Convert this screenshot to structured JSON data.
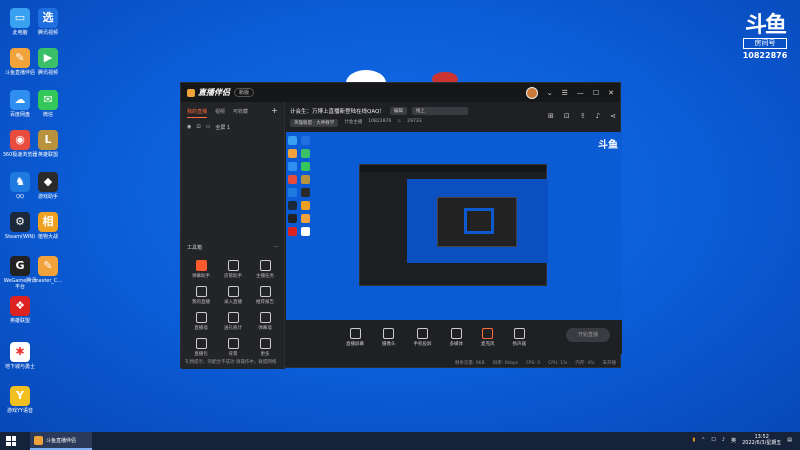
{
  "desktop": {
    "icons": [
      {
        "name": "computer-icon",
        "label": "此电脑",
        "color": "#3aa0f0",
        "glyph": "▭"
      },
      {
        "name": "app-icon-1",
        "label": "腾讯视频",
        "color": "#1f6fe0",
        "glyph": "选"
      },
      {
        "name": "douyu-live-icon",
        "label": "斗鱼直播伴侣",
        "color": "#f2a23a",
        "glyph": "✎"
      },
      {
        "name": "video-icon",
        "label": "腾讯视频",
        "color": "#3bc06a",
        "glyph": "▶"
      },
      {
        "name": "cloud-icon",
        "label": "百度网盘",
        "color": "#2f8ff0",
        "glyph": "☁"
      },
      {
        "name": "wechat-icon",
        "label": "微信",
        "color": "#34c759",
        "glyph": "✉"
      },
      {
        "name": "browser-icon",
        "label": "360极速浏览器",
        "color": "#e94b3c",
        "glyph": "◉"
      },
      {
        "name": "lol-icon",
        "label": "英雄联盟",
        "color": "#b8923c",
        "glyph": "L"
      },
      {
        "name": "qq-icon",
        "label": "QQ",
        "color": "#1f7ae0",
        "glyph": "♞"
      },
      {
        "name": "game-icon",
        "label": "游戏助手",
        "color": "#2a2a2a",
        "glyph": "◆"
      },
      {
        "name": "steam-icon",
        "label": "Steam(WIN)",
        "color": "#1b2838",
        "glyph": "⚙"
      },
      {
        "name": "game2-icon",
        "label": "植物大战",
        "color": "#f0a020",
        "glyph": "相"
      },
      {
        "name": "wegame-icon",
        "label": "WeGame腾讯平台",
        "color": "#222",
        "glyph": "G"
      },
      {
        "name": "master-icon",
        "label": "master_C...",
        "color": "#f2a23a",
        "glyph": "✎"
      },
      {
        "name": "game3-icon",
        "label": "英雄联盟",
        "color": "#d22",
        "glyph": "❖"
      },
      {
        "name": "app2-icon",
        "label": "地下城与勇士",
        "color": "#fff",
        "glyph": "✱"
      },
      {
        "name": "yy-icon",
        "label": "游戏YY语音",
        "color": "#f0c020",
        "glyph": "Y"
      }
    ],
    "brand": {
      "logo": "斗鱼",
      "room_label": "房间号",
      "room_number": "10822876"
    }
  },
  "app": {
    "name": "直播伴侣",
    "version": "新版",
    "left_tabs": [
      "我的直播",
      "视频",
      "可收藏"
    ],
    "scene_label": "全屏 1",
    "tools_title": "工具箱",
    "tools": [
      "弹幕助手",
      "房管助手",
      "主播任务",
      "我的直播",
      "录入直播",
      "推荐报告",
      "直播墙",
      "送礼统计",
      "弹幕墙",
      "直播包",
      "背景",
      "更多"
    ],
    "notice": "礼物提示、的配合不成功 请操作中，联盟网络",
    "info": {
      "title": "计会生：万博上直播新登陆在线QAQ！",
      "edit": "编辑",
      "category": "线上",
      "tag": "英雄联盟 · 大神教学",
      "room_label": "计会主播",
      "room": "10822876",
      "hot": "29733"
    },
    "bottom_tools": [
      "直播屏幕",
      "摄像头",
      "手机投屏",
      "多媒体",
      "麦克风",
      "扬声器"
    ],
    "start_live": "开始直播",
    "status": [
      "剩余流量: 0KB",
      "码率: 0kbps",
      "FPS: 0",
      "CPU: 1%",
      "内存: 4%",
      "未开播"
    ]
  },
  "taskbar": {
    "app_label": "斗鱼直播伴侣",
    "lang": "英",
    "time": "13:52",
    "date": "2022/6/3/星期五"
  }
}
